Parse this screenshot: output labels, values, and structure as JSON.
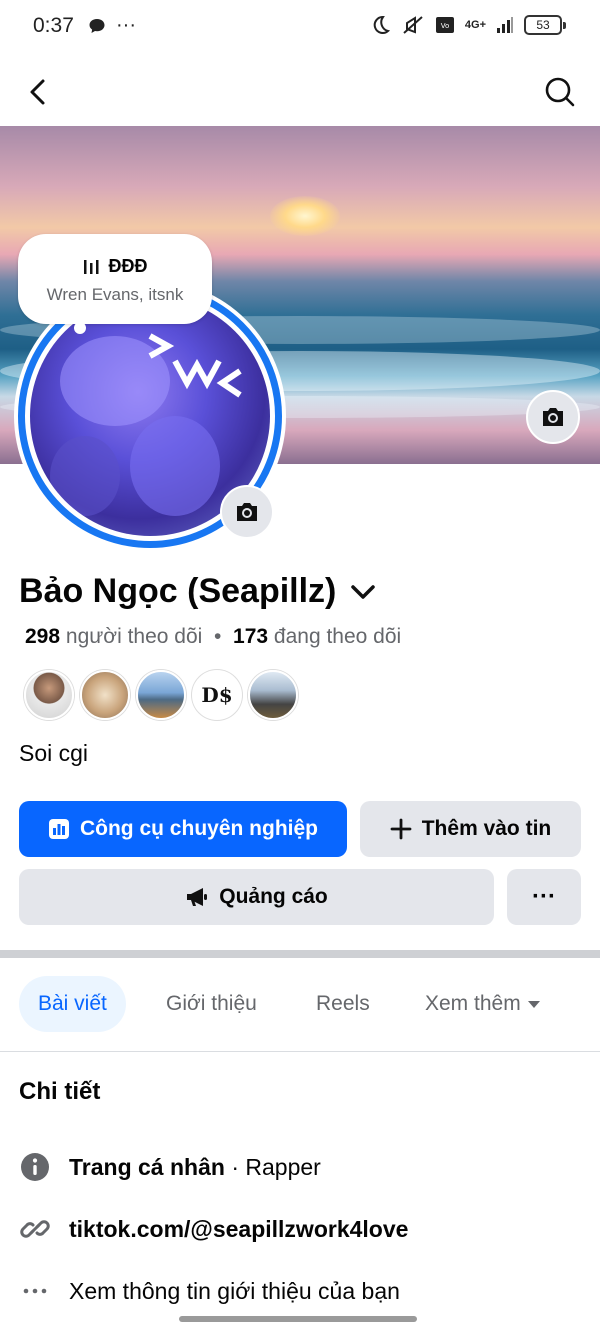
{
  "status_bar": {
    "time": "0:37",
    "battery": "53",
    "network": "4G+"
  },
  "note": {
    "title": "ĐĐĐ",
    "artists": "Wren Evans, itsnk"
  },
  "profile": {
    "name": "Bảo Ngọc (Seapillz)",
    "followers_count": "298",
    "followers_label": "người theo dõi",
    "following_count": "173",
    "following_label": "đang theo dõi",
    "bio": "Soi cgi"
  },
  "buttons": {
    "professional_tools": "Công cụ chuyên nghiệp",
    "add_to_story": "Thêm vào tin",
    "ads": "Quảng cáo",
    "more": "···"
  },
  "tabs": [
    {
      "label": "Bài viết",
      "active": true
    },
    {
      "label": "Giới thiệu",
      "active": false
    },
    {
      "label": "Reels",
      "active": false
    },
    {
      "label": "Xem thêm",
      "active": false
    }
  ],
  "details": {
    "title": "Chi tiết",
    "page_type_label": "Trang cá nhân",
    "page_type_value": " · Rapper",
    "link": "tiktok.com/@seapillzwork4love",
    "see_about": "Xem thông tin giới thiệu của bạn"
  },
  "colors": {
    "accent": "#0866ff",
    "ring": "#1877f2",
    "secondary_bg": "#e4e6eb"
  }
}
